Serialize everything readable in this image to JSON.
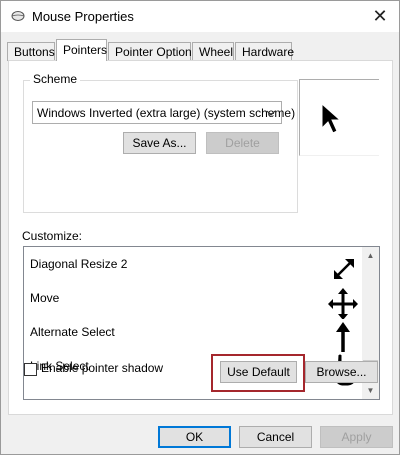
{
  "window": {
    "title": "Mouse Properties",
    "close_glyph": "✕",
    "icon": "mouse-icon"
  },
  "tabs": [
    {
      "label": "Buttons",
      "active": false
    },
    {
      "label": "Pointers",
      "active": true
    },
    {
      "label": "Pointer Options",
      "active": false
    },
    {
      "label": "Wheel",
      "active": false
    },
    {
      "label": "Hardware",
      "active": false
    }
  ],
  "scheme": {
    "group_label": "Scheme",
    "selected": "Windows Inverted (extra large) (system scheme)",
    "save_as_label": "Save As...",
    "delete_label": "Delete"
  },
  "preview": {
    "icon": "arrow-cursor-icon"
  },
  "customize": {
    "label": "Customize:",
    "items": [
      {
        "label": "Diagonal Resize 2",
        "icon": "diagonal-resize-2-icon"
      },
      {
        "label": "Move",
        "icon": "move-icon"
      },
      {
        "label": "Alternate Select",
        "icon": "up-arrow-icon"
      },
      {
        "label": "Link Select",
        "icon": "hand-pointer-icon"
      }
    ]
  },
  "shadow": {
    "label": "Enable pointer shadow",
    "checked": false
  },
  "buttons": {
    "use_default": "Use Default",
    "browse": "Browse...",
    "ok": "OK",
    "cancel": "Cancel",
    "apply": "Apply"
  },
  "colors": {
    "highlight_border": "#a5272d",
    "default_button_border": "#0078d7"
  }
}
